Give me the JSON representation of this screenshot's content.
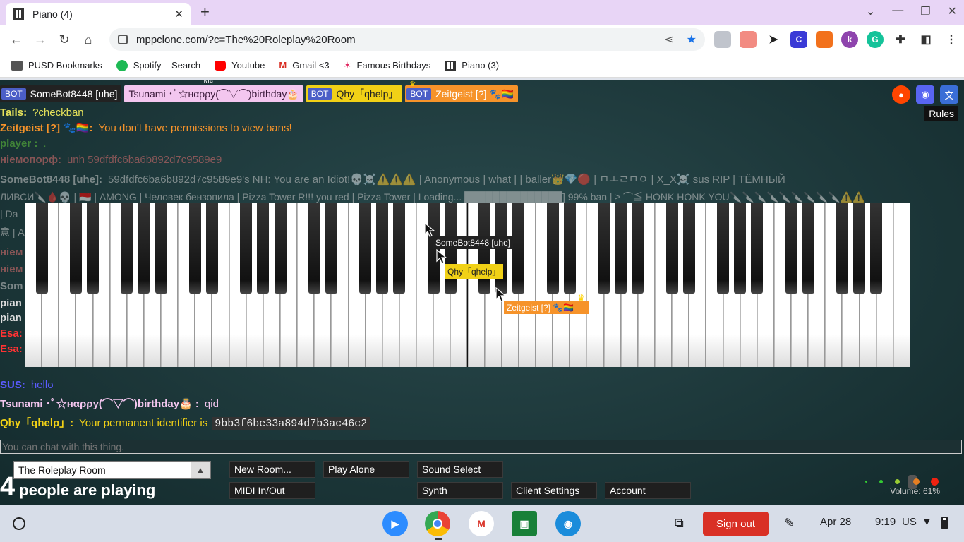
{
  "browser": {
    "tab_title": "Piano (4)",
    "url": "mppclone.com/?c=The%20Roleplay%20Room",
    "bookmarks": [
      "PUSD Bookmarks",
      "Spotify – Search",
      "Youtube",
      "Gmail <3",
      "Famous Birthdays",
      "Piano (3)"
    ]
  },
  "room": {
    "users": [
      {
        "bot": true,
        "bot_label": "BOT",
        "name": "SomeBot8448 [uhe]",
        "bg": "#222222",
        "color": "#ffffff"
      },
      {
        "bot": false,
        "name": "Tsunami ･ﾟ☆нαρρу(⌒▽⌒)birthday🎂",
        "bg": "#f3c6ef",
        "color": "#3a1a3a",
        "me": "Me"
      },
      {
        "bot": true,
        "bot_label": "BOT",
        "name": "Qhy「qhelp」",
        "bg": "#f1d116",
        "color": "#222222"
      },
      {
        "bot": true,
        "bot_label": "BOT",
        "name": "Zeitgeist [?] 🐾🏳️‍🌈",
        "bg": "#f6932a",
        "color": "#ffffff",
        "crown": "♛"
      }
    ],
    "rules_label": "Rules",
    "chat": [
      {
        "name": "Tails:",
        "text": "?checkban",
        "color": "#e4e05a"
      },
      {
        "name": "Zeitgeist [?] 🐾🏳️‍🌈:",
        "text": "You don't have permissions to view bans!",
        "color": "#f6932a"
      },
      {
        "name": "player :",
        "text": ".",
        "color": "#63c83b"
      },
      {
        "name": "ніемопорф:",
        "text": "unh 59dfdfc6ba6b892d7c9589e9",
        "color": "#e07070"
      },
      {
        "name": "SomeBot8448 [uhe]:",
        "text": "59dfdfc6ba6b892d7c9589e9's NH: You are an Idiot!💀☠️⚠️⚠️⚠️ | Anonymous | what |               | baller👑💎🔴 | ㅁㅗㄹㅁㅇ | X_X☠️ sus RIP | ТЁМНЫЙ",
        "color": "#cccccc"
      },
      {
        "name": "",
        "text": "ЛИВСИ🔪🩸💀 | 🇮🇩 | AMONG | Человек бензопила | Pizza Tower R!!! you red | Pizza Tower | Loading... ██████████████] 99% ban | ≥ ⌒≦ HONK HONK YOU🔪🔪🔪🔪🔪🔪🔪🔪🔪⚠️⚠️",
        "color": "#cccccc"
      },
      {
        "name": "SUS:",
        "text": "hello",
        "color": "#5b5bff"
      },
      {
        "name": "Tsunami ･ﾟ☆нαρρу(⌒▽⌒)birthday🎂 :",
        "text": "qid",
        "color": "#f3c6ef"
      },
      {
        "name": "Qhy「qhelp」:",
        "text": "Your permanent identifier is",
        "code": "9bb3f6be33a894d7b3ac46c2",
        "color": "#f1d116"
      }
    ],
    "side_names": [
      "ніем",
      "ніем",
      "Som",
      "pian",
      "pian",
      "Esa:",
      "Esa:"
    ],
    "side_fragments": [
      "| Da",
      "意 | A"
    ],
    "cursors": [
      {
        "label": "SomeBot8448 [uhe]",
        "bg": "#222222",
        "color": "#ffffff"
      },
      {
        "label": "Qhy「qhelp」",
        "bg": "#f1d116",
        "color": "#222222"
      },
      {
        "label": "Zeitgeist [?] 🐾🏳️‍🌈",
        "bg": "#f6932a",
        "color": "#ffffff"
      }
    ],
    "chat_placeholder": "You can chat with this thing.",
    "room_name": "The Roleplay Room",
    "people_count": "4",
    "people_text": "people are playing",
    "buttons": {
      "new_room": "New Room...",
      "play_alone": "Play Alone",
      "sound_select": "Sound Select",
      "midi": "MIDI In/Out",
      "synth": "Synth",
      "client_settings": "Client Settings",
      "account": "Account"
    },
    "volume_label": "Volume: 61%",
    "volume": 0.61
  },
  "shelf": {
    "sign_out": "Sign out",
    "date": "Apr 28",
    "time": "9:19",
    "locale": "US"
  }
}
